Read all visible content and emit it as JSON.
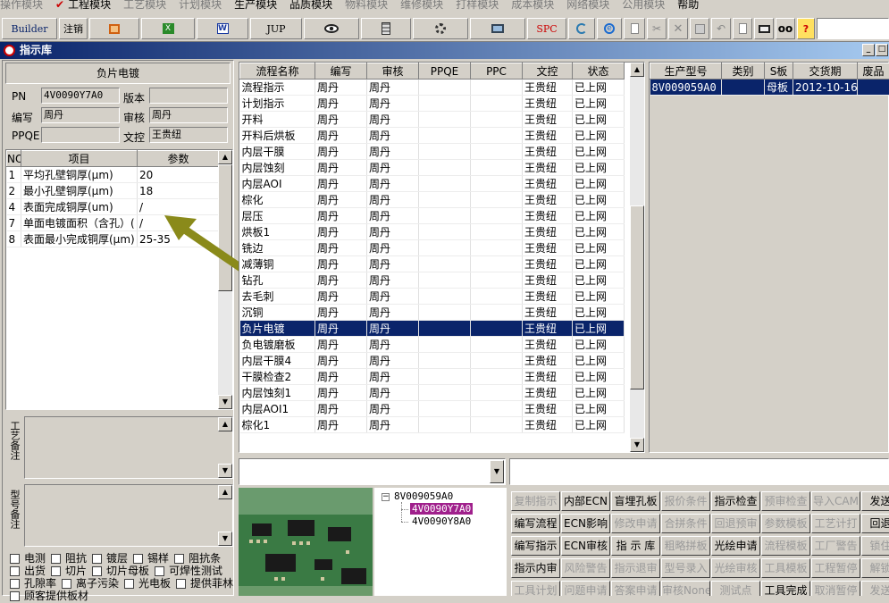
{
  "menu": {
    "items": [
      {
        "label": "操作模块",
        "active": false
      },
      {
        "label": "工程模块",
        "active": true
      },
      {
        "label": "工艺模块",
        "active": false
      },
      {
        "label": "计划模块",
        "active": false
      },
      {
        "label": "生产模块",
        "active": true
      },
      {
        "label": "品质模块",
        "active": true
      },
      {
        "label": "物料模块",
        "active": false
      },
      {
        "label": "维修模块",
        "active": false
      },
      {
        "label": "打样模块",
        "active": false
      },
      {
        "label": "成本模块",
        "active": false
      },
      {
        "label": "网络模块",
        "active": false
      },
      {
        "label": "公用模块",
        "active": false
      },
      {
        "label": "帮助",
        "active": true
      }
    ]
  },
  "toolbar": {
    "builder": "Builder",
    "logout": "注销",
    "jup": "JUP",
    "spc": "SPC",
    "help": "?"
  },
  "window": {
    "title": "指示库"
  },
  "left": {
    "header": "负片电镀",
    "pn_label": "PN",
    "pn_value": "4V0090Y7A0",
    "version_label": "版本",
    "version_value": "",
    "author_label": "编写",
    "author_value": "周丹",
    "reviewer_label": "审核",
    "reviewer_value": "周丹",
    "ppqe_label": "PPQE",
    "ppqe_value": "",
    "dc_label": "文控",
    "dc_value": "王贵纽",
    "param_columns": [
      "NO",
      "项目",
      "参数"
    ],
    "params": [
      {
        "no": "1",
        "item": "平均孔壁铜厚(μm)",
        "value": "20"
      },
      {
        "no": "2",
        "item": "最小孔壁铜厚(μm)",
        "value": "18"
      },
      {
        "no": "4",
        "item": "表面完成铜厚(um)",
        "value": "/"
      },
      {
        "no": "7",
        "item": "单面电镀面积（含孔）(",
        "value": "/"
      },
      {
        "no": "8",
        "item": "表面最小完成铜厚(μm)",
        "value": "25-35"
      }
    ],
    "craft_note_label": "工艺备注",
    "model_note_label": "型号备注",
    "checkbox_rows": [
      [
        "电测",
        "阻抗",
        "镀层",
        "锡样",
        "阻抗条"
      ],
      [
        "出货",
        "切片",
        "切片母板",
        "可焊性测试"
      ],
      [
        "孔隙率",
        "离子污染",
        "光电板",
        "提供菲林"
      ],
      [
        "顾客提供板材"
      ]
    ]
  },
  "flow": {
    "columns": [
      "流程名称",
      "编写",
      "审核",
      "PPQE",
      "PPC",
      "文控",
      "状态"
    ],
    "rows": [
      [
        "流程指示",
        "周丹",
        "周丹",
        "",
        "",
        "王贵纽",
        "已上网"
      ],
      [
        "计划指示",
        "周丹",
        "周丹",
        "",
        "",
        "王贵纽",
        "已上网"
      ],
      [
        "开料",
        "周丹",
        "周丹",
        "",
        "",
        "王贵纽",
        "已上网"
      ],
      [
        "开料后烘板",
        "周丹",
        "周丹",
        "",
        "",
        "王贵纽",
        "已上网"
      ],
      [
        "内层干膜",
        "周丹",
        "周丹",
        "",
        "",
        "王贵纽",
        "已上网"
      ],
      [
        "内层蚀刻",
        "周丹",
        "周丹",
        "",
        "",
        "王贵纽",
        "已上网"
      ],
      [
        "内层AOI",
        "周丹",
        "周丹",
        "",
        "",
        "王贵纽",
        "已上网"
      ],
      [
        "棕化",
        "周丹",
        "周丹",
        "",
        "",
        "王贵纽",
        "已上网"
      ],
      [
        "层压",
        "周丹",
        "周丹",
        "",
        "",
        "王贵纽",
        "已上网"
      ],
      [
        "烘板1",
        "周丹",
        "周丹",
        "",
        "",
        "王贵纽",
        "已上网"
      ],
      [
        "铣边",
        "周丹",
        "周丹",
        "",
        "",
        "王贵纽",
        "已上网"
      ],
      [
        "减薄铜",
        "周丹",
        "周丹",
        "",
        "",
        "王贵纽",
        "已上网"
      ],
      [
        "钻孔",
        "周丹",
        "周丹",
        "",
        "",
        "王贵纽",
        "已上网"
      ],
      [
        "去毛刺",
        "周丹",
        "周丹",
        "",
        "",
        "王贵纽",
        "已上网"
      ],
      [
        "沉铜",
        "周丹",
        "周丹",
        "",
        "",
        "王贵纽",
        "已上网"
      ],
      [
        "负片电镀",
        "周丹",
        "周丹",
        "",
        "",
        "王贵纽",
        "已上网"
      ],
      [
        "负电镀磨板",
        "周丹",
        "周丹",
        "",
        "",
        "王贵纽",
        "已上网"
      ],
      [
        "内层干膜4",
        "周丹",
        "周丹",
        "",
        "",
        "王贵纽",
        "已上网"
      ],
      [
        "干膜检查2",
        "周丹",
        "周丹",
        "",
        "",
        "王贵纽",
        "已上网"
      ],
      [
        "内层蚀刻1",
        "周丹",
        "周丹",
        "",
        "",
        "王贵纽",
        "已上网"
      ],
      [
        "内层AOI1",
        "周丹",
        "周丹",
        "",
        "",
        "王贵纽",
        "已上网"
      ],
      [
        "棕化1",
        "周丹",
        "周丹",
        "",
        "",
        "王贵纽",
        "已上网"
      ]
    ],
    "selected_index": 15
  },
  "models": {
    "columns": [
      "生产型号",
      "类别",
      "S板",
      "交货期",
      "废品"
    ],
    "rows": [
      [
        "8V009059A0",
        "",
        "母板",
        "2012-10-16",
        ""
      ]
    ]
  },
  "tree": {
    "root": "8V009059A0",
    "children": [
      {
        "label": "4V0090Y7A0",
        "selected": true
      },
      {
        "label": "4V0090Y8A0",
        "selected": false
      }
    ]
  },
  "actions": {
    "rows": [
      [
        {
          "label": "复制指示",
          "enabled": false
        },
        {
          "label": "内部ECN",
          "enabled": true
        },
        {
          "label": "盲埋孔板",
          "enabled": true
        },
        {
          "label": "报价条件",
          "enabled": false
        },
        {
          "label": "指示检查",
          "enabled": true
        },
        {
          "label": "预审检查",
          "enabled": false
        },
        {
          "label": "导入CAM",
          "enabled": false
        },
        {
          "label": "发送指",
          "enabled": true
        }
      ],
      [
        {
          "label": "编写流程",
          "enabled": true
        },
        {
          "label": "ECN影响",
          "enabled": true
        },
        {
          "label": "修改申请",
          "enabled": false
        },
        {
          "label": "合拼条件",
          "enabled": false
        },
        {
          "label": "回退预审",
          "enabled": false
        },
        {
          "label": "参数模板",
          "enabled": false
        },
        {
          "label": "工艺计打",
          "enabled": false
        },
        {
          "label": "回退指",
          "enabled": true
        }
      ],
      [
        {
          "label": "编写指示",
          "enabled": true
        },
        {
          "label": "ECN审核",
          "enabled": true
        },
        {
          "label": "指 示 库",
          "enabled": true
        },
        {
          "label": "粗略拼板",
          "enabled": false
        },
        {
          "label": "光绘申请",
          "enabled": true
        },
        {
          "label": "流程模板",
          "enabled": false
        },
        {
          "label": "工厂警告",
          "enabled": false
        },
        {
          "label": "锁住编",
          "enabled": false
        }
      ],
      [
        {
          "label": "指示内审",
          "enabled": true
        },
        {
          "label": "风险警告",
          "enabled": false
        },
        {
          "label": "指示退审",
          "enabled": false
        },
        {
          "label": "型号录入",
          "enabled": false
        },
        {
          "label": "光绘审核",
          "enabled": false
        },
        {
          "label": "工具模板",
          "enabled": false
        },
        {
          "label": "工程暂停",
          "enabled": false
        },
        {
          "label": "解锁编",
          "enabled": false
        }
      ],
      [
        {
          "label": "工具计划",
          "enabled": false
        },
        {
          "label": "问题申请",
          "enabled": false
        },
        {
          "label": "答案申请",
          "enabled": false
        },
        {
          "label": "审核None",
          "enabled": false
        },
        {
          "label": "测试点",
          "enabled": false
        },
        {
          "label": "工具完成",
          "enabled": true
        },
        {
          "label": "取消暂停",
          "enabled": false
        },
        {
          "label": "发送报",
          "enabled": false
        }
      ]
    ]
  },
  "colors": {
    "selection": "#0a246a",
    "tree_selection": "#a0208c",
    "arrow": "#8a8a1a",
    "face": "#d4d0c8"
  }
}
